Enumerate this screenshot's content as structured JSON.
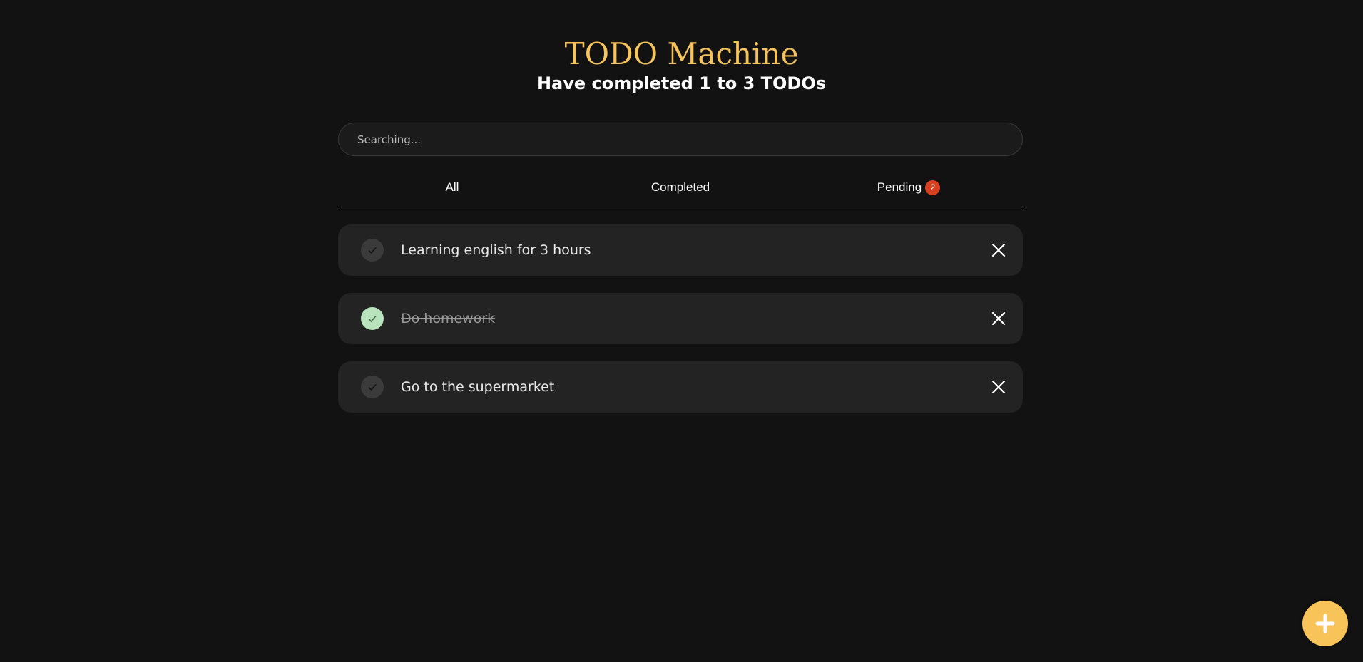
{
  "header": {
    "title": "TODO Machine",
    "subtitle": "Have completed 1 to 3 TODOs"
  },
  "search": {
    "placeholder": "Searching..."
  },
  "tabs": [
    {
      "label": "All"
    },
    {
      "label": "Completed"
    },
    {
      "label": "Pending",
      "badge": "2"
    }
  ],
  "todos": [
    {
      "text": "Learning english for 3 hours",
      "completed": false
    },
    {
      "text": "Do homework",
      "completed": true
    },
    {
      "text": "Go to the supermarket",
      "completed": false
    }
  ],
  "colors": {
    "background": "#121212",
    "accent": "#f7c45c",
    "badge": "#d9411e",
    "completed_check": "#b8e3bd"
  },
  "icons": {
    "check": "check-icon",
    "delete": "close-icon",
    "add": "plus-icon"
  }
}
